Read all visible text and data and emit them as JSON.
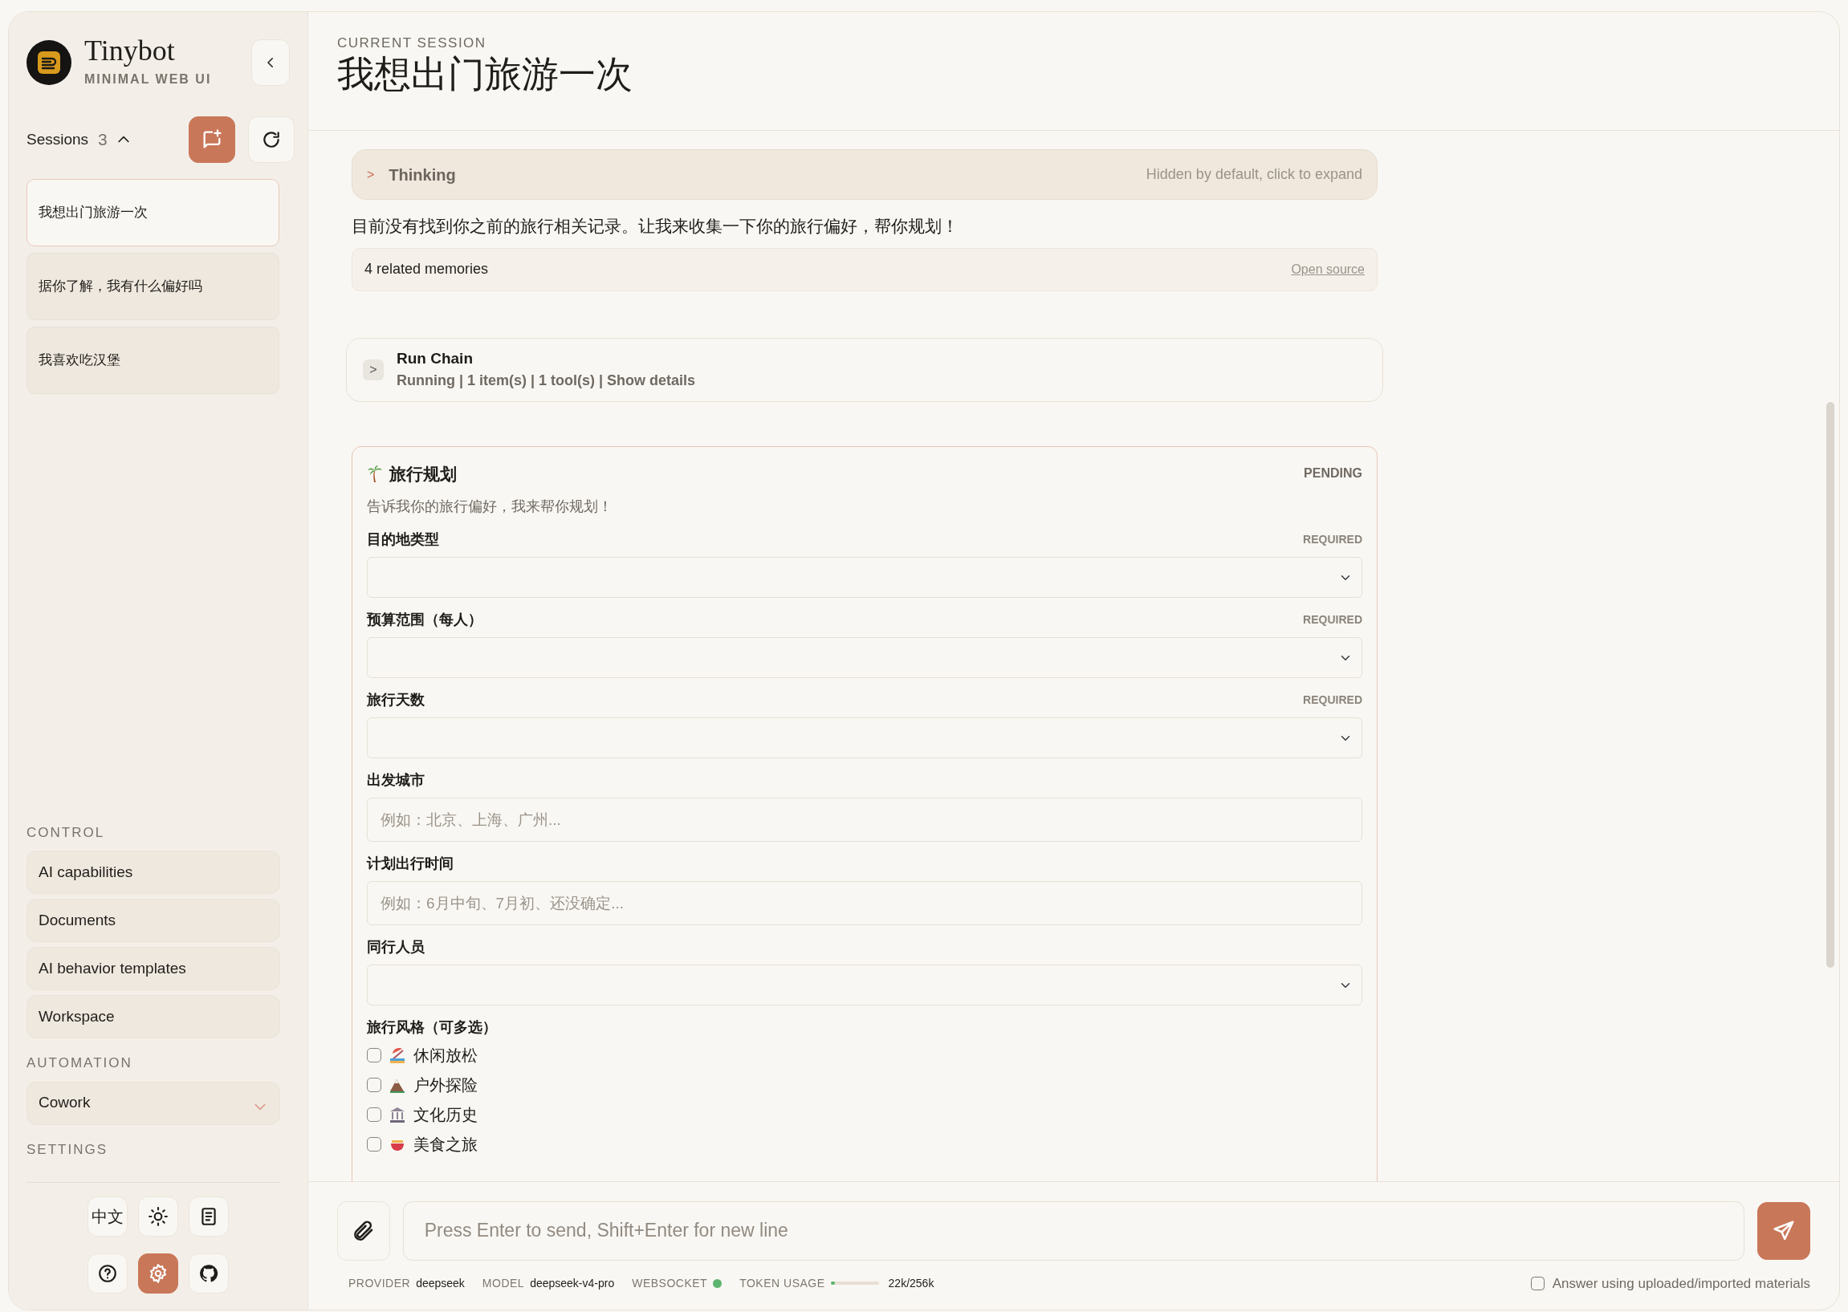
{
  "app": {
    "name": "Tinybot",
    "subtitle": "MINIMAL WEB UI"
  },
  "sessions": {
    "label": "Sessions",
    "count": "3",
    "expanded": true,
    "items": [
      {
        "title": "我想出门旅游一次",
        "selected": true
      },
      {
        "title": "据你了解，我有什么偏好吗",
        "selected": false
      },
      {
        "title": "我喜欢吃汉堡",
        "selected": false
      }
    ]
  },
  "sidebar_sections": [
    {
      "heading": "CONTROL",
      "items": [
        {
          "label": "AI capabilities",
          "kind": "link"
        },
        {
          "label": "Documents",
          "kind": "link"
        },
        {
          "label": "AI behavior templates",
          "kind": "link"
        },
        {
          "label": "Workspace",
          "kind": "link"
        }
      ]
    },
    {
      "heading": "AUTOMATION",
      "items": [
        {
          "label": "Cowork",
          "kind": "dropdown"
        }
      ]
    },
    {
      "heading": "SETTINGS"
    }
  ],
  "settings_buttons": [
    {
      "kind": "language",
      "label": "中文",
      "selected": false
    },
    {
      "kind": "theme",
      "selected": false
    },
    {
      "kind": "docs",
      "selected": false
    },
    {
      "kind": "help",
      "selected": false
    },
    {
      "kind": "settings",
      "selected": true
    },
    {
      "kind": "github",
      "selected": false
    }
  ],
  "header": {
    "eyebrow": "CURRENT SESSION",
    "title": "我想出门旅游一次"
  },
  "thinking": {
    "toggle": ">",
    "label": "Thinking",
    "hint": "Hidden by default, click to expand"
  },
  "reply": "目前没有找到你之前的旅行相关记录。让我来收集一下你的旅行偏好，帮你规划！",
  "memories": {
    "label": "4 related memories",
    "action": "Open source"
  },
  "run_chain": {
    "toggle": ">",
    "title": "Run Chain",
    "status": "Running | 1 item(s) | 1 tool(s) | Show details"
  },
  "form": {
    "title": "旅行规划",
    "status": "PENDING",
    "description": "告诉我你的旅行偏好，我来帮你规划！",
    "fields": [
      {
        "kind": "select",
        "label": "目的地类型",
        "required_label": "REQUIRED"
      },
      {
        "kind": "select",
        "label": "预算范围（每人）",
        "required_label": "REQUIRED"
      },
      {
        "kind": "select",
        "label": "旅行天数",
        "required_label": "REQUIRED"
      },
      {
        "kind": "text",
        "label": "出发城市",
        "placeholder": "例如：北京、上海、广州..."
      },
      {
        "kind": "text",
        "label": "计划出行时间",
        "placeholder": "例如：6月中旬、7月初、还没确定..."
      },
      {
        "kind": "select",
        "label": "同行人员"
      },
      {
        "kind": "checkboxes",
        "label": "旅行风格（可多选）",
        "options": [
          {
            "label": "休闲放松",
            "checked": false
          },
          {
            "label": "户外探险",
            "checked": false
          },
          {
            "label": "文化历史",
            "checked": false
          },
          {
            "label": "美食之旅",
            "checked": false
          }
        ]
      }
    ]
  },
  "composer": {
    "placeholder": "Press Enter to send, Shift+Enter for new line"
  },
  "status_bar": [
    {
      "kind": "text",
      "label": "PROVIDER",
      "value": "deepseek"
    },
    {
      "kind": "text",
      "label": "MODEL",
      "value": "deepseek-v4-pro"
    },
    {
      "kind": "dot",
      "label": "WEBSOCKET",
      "connected": true
    },
    {
      "kind": "meter",
      "label": "TOKEN USAGE",
      "level": 0.086,
      "value": "22k/256k"
    }
  ],
  "materials_option": {
    "label": "Answer using uploaded/imported materials",
    "checked": false
  }
}
